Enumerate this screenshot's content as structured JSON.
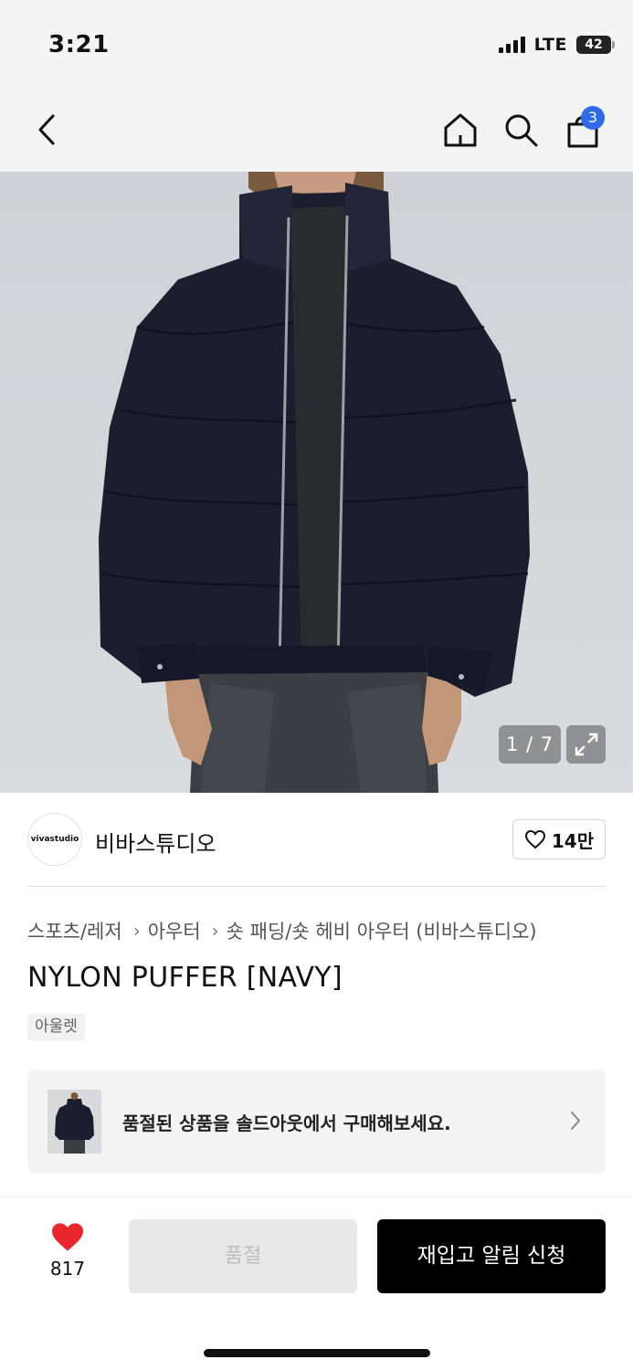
{
  "status_bar": {
    "time": "3:21",
    "network": "LTE",
    "battery": "42"
  },
  "nav": {
    "cart_count": "3"
  },
  "gallery": {
    "counter": "1 / 7"
  },
  "brand": {
    "logo_text": "vivastudio",
    "name": "비바스튜디오",
    "likes": "14만"
  },
  "breadcrumb": [
    "스포츠/레저",
    "아우터",
    "숏 패딩/숏 헤비 아우터 (비바스튜디오)"
  ],
  "product": {
    "title": "NYLON PUFFER [NAVY]",
    "tag": "아울렛"
  },
  "banner": {
    "text": "품절된 상품을 솔드아웃에서 구매해보세요."
  },
  "bottom": {
    "wish_count": "817",
    "soldout_label": "품절",
    "restock_label": "재입고 알림 신청"
  },
  "colors": {
    "accent_blue": "#2f6ae8",
    "heart_red": "#e8262b",
    "jacket_navy": "#1b1e2e"
  }
}
